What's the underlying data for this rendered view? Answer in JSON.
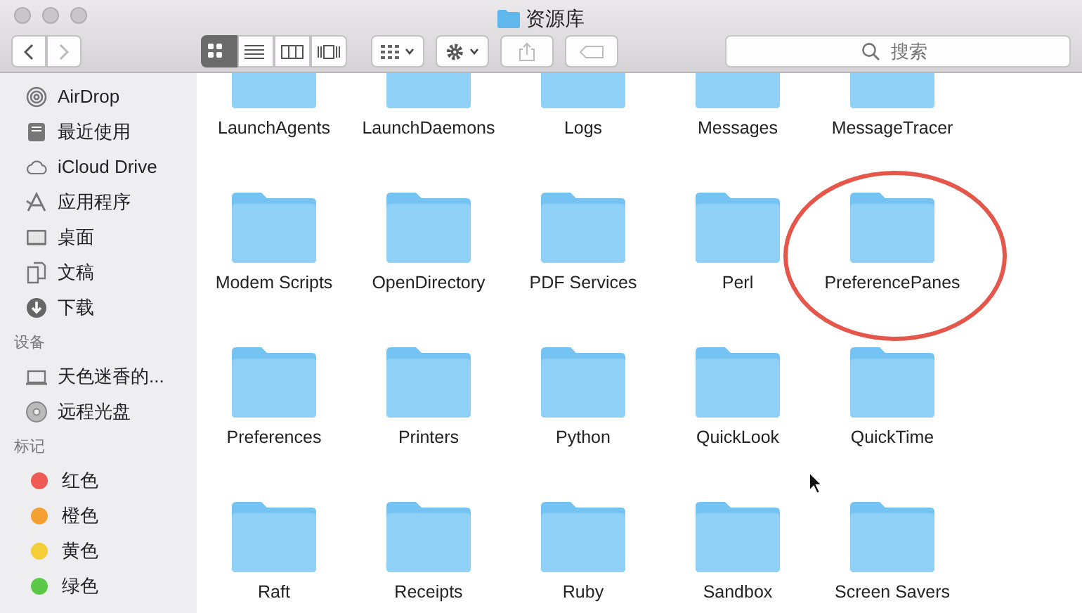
{
  "window": {
    "title": "资源库"
  },
  "toolbar": {
    "view_modes": [
      {
        "selected": true
      },
      {
        "selected": false
      },
      {
        "selected": false
      },
      {
        "selected": false
      }
    ],
    "search": {
      "placeholder": "搜索"
    }
  },
  "sidebar": {
    "sections": [
      {
        "items": [
          {
            "label": "AirDrop"
          },
          {
            "label": "最近使用"
          },
          {
            "label": "iCloud Drive"
          },
          {
            "label": "应用程序"
          },
          {
            "label": "桌面"
          },
          {
            "label": "文稿"
          },
          {
            "label": "下载"
          }
        ]
      },
      {
        "header": "设备",
        "items": [
          {
            "label": "天色迷香的..."
          },
          {
            "label": "远程光盘"
          }
        ]
      },
      {
        "header": "标记",
        "items": [
          {
            "label": "红色",
            "color": "#f05a56"
          },
          {
            "label": "橙色",
            "color": "#f4a033"
          },
          {
            "label": "黄色",
            "color": "#f5cf3a"
          },
          {
            "label": "绿色",
            "color": "#5cc847"
          }
        ]
      }
    ]
  },
  "folders": [
    {
      "name": "LaunchAgents",
      "highlighted": false
    },
    {
      "name": "LaunchDaemons",
      "highlighted": false
    },
    {
      "name": "Logs",
      "highlighted": false
    },
    {
      "name": "Messages",
      "highlighted": false
    },
    {
      "name": "MessageTracer",
      "highlighted": false
    },
    {
      "name": "Modem Scripts",
      "highlighted": false
    },
    {
      "name": "OpenDirectory",
      "highlighted": false
    },
    {
      "name": "PDF Services",
      "highlighted": false
    },
    {
      "name": "Perl",
      "highlighted": false
    },
    {
      "name": "PreferencePanes",
      "highlighted": true
    },
    {
      "name": "Preferences",
      "highlighted": false
    },
    {
      "name": "Printers",
      "highlighted": false
    },
    {
      "name": "Python",
      "highlighted": false
    },
    {
      "name": "QuickLook",
      "highlighted": false
    },
    {
      "name": "QuickTime",
      "highlighted": false
    },
    {
      "name": "Raft",
      "highlighted": false
    },
    {
      "name": "Receipts",
      "highlighted": false
    },
    {
      "name": "Ruby",
      "highlighted": false
    },
    {
      "name": "Sandbox",
      "highlighted": false
    },
    {
      "name": "Screen Savers",
      "highlighted": false
    }
  ]
}
